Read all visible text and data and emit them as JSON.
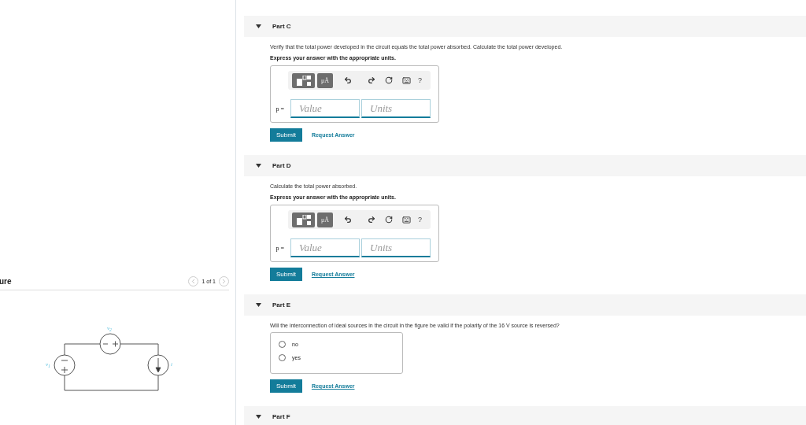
{
  "figure": {
    "title": "ure",
    "pager": "1 of 1",
    "labels": {
      "top": "v$_{2}$",
      "left": "v$_{1}$",
      "right": "i"
    }
  },
  "parts": [
    {
      "title": "Part C",
      "expanded": true,
      "kind": "answer",
      "prompt": "Verify that the total power developed in the circuit equals the total power absorbed. Calculate the total power developed.",
      "instruction": "Express your answer with the appropriate units.",
      "units_button": "μÅ",
      "help": "?",
      "variable": "p =",
      "value_placeholder": "Value",
      "units_placeholder": "Units",
      "submit": "Submit",
      "request": "Request Answer",
      "underlined": false
    },
    {
      "title": "Part D",
      "expanded": true,
      "kind": "answer",
      "prompt": "Calculate the total power absorbed.",
      "instruction": "Express your answer with the appropriate units.",
      "units_button": "μÅ",
      "help": "?",
      "variable": "p =",
      "value_placeholder": "Value",
      "units_placeholder": "Units",
      "submit": "Submit",
      "request": "Request Answer",
      "underlined": true
    },
    {
      "title": "Part E",
      "expanded": true,
      "kind": "choice",
      "prompt": "Will the interconnection of ideal sources in the circuit in the figure be valid if the polarity of the 16 V source is reversed?",
      "options": [
        {
          "label": "no",
          "selected": false
        },
        {
          "label": "yes",
          "selected": false
        }
      ],
      "submit": "Submit",
      "request": "Request Answer",
      "underlined": true
    },
    {
      "title": "Part F",
      "expanded": true,
      "kind": "header"
    }
  ]
}
